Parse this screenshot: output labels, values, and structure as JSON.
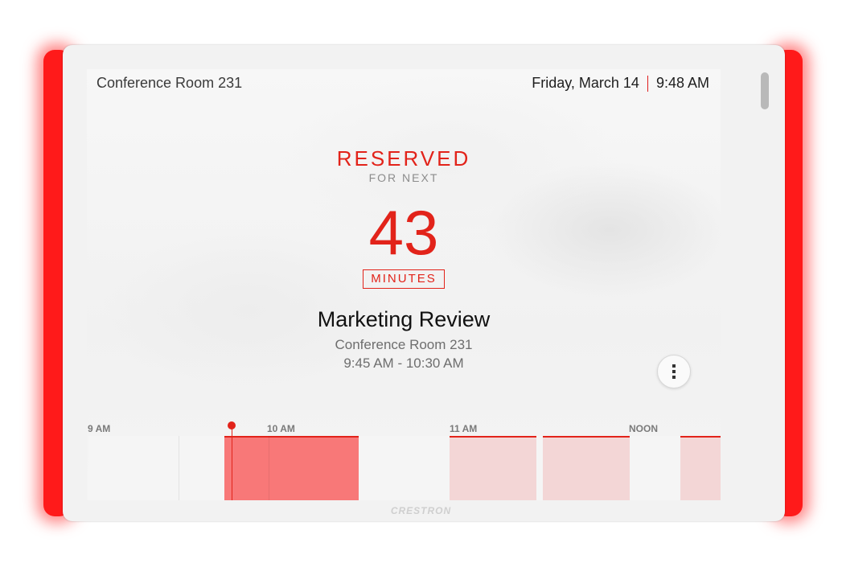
{
  "header": {
    "room_name": "Conference Room 231",
    "date": "Friday, March 14",
    "time": "9:48 AM"
  },
  "status": {
    "title": "RESERVED",
    "subtitle": "FOR NEXT",
    "countdown": "43",
    "unit": "MINUTES"
  },
  "meeting": {
    "title": "Marketing Review",
    "room": "Conference Room 231",
    "time_range": "9:45 AM - 10:30 AM"
  },
  "timeline": {
    "ticks": [
      "9 AM",
      "10 AM",
      "11 AM",
      "NOON"
    ],
    "current_time": "9:48 AM",
    "reservations": [
      {
        "start": "9:45 AM",
        "end": "10:30 AM",
        "state": "current"
      },
      {
        "start": "11:00 AM",
        "end": "11:30 AM",
        "state": "booked"
      },
      {
        "start": "11:30 AM",
        "end": "12:00 PM",
        "state": "booked"
      },
      {
        "start": "12:15 PM",
        "end": "",
        "state": "booked"
      }
    ]
  },
  "brand": "CRESTRON",
  "colors": {
    "accent": "#e2231a",
    "glow": "#ff1a1a",
    "current_slot": "#f87878",
    "booked_slot": "#f3d6d6"
  },
  "icons": {
    "menu": "vertical-ellipsis-icon"
  }
}
